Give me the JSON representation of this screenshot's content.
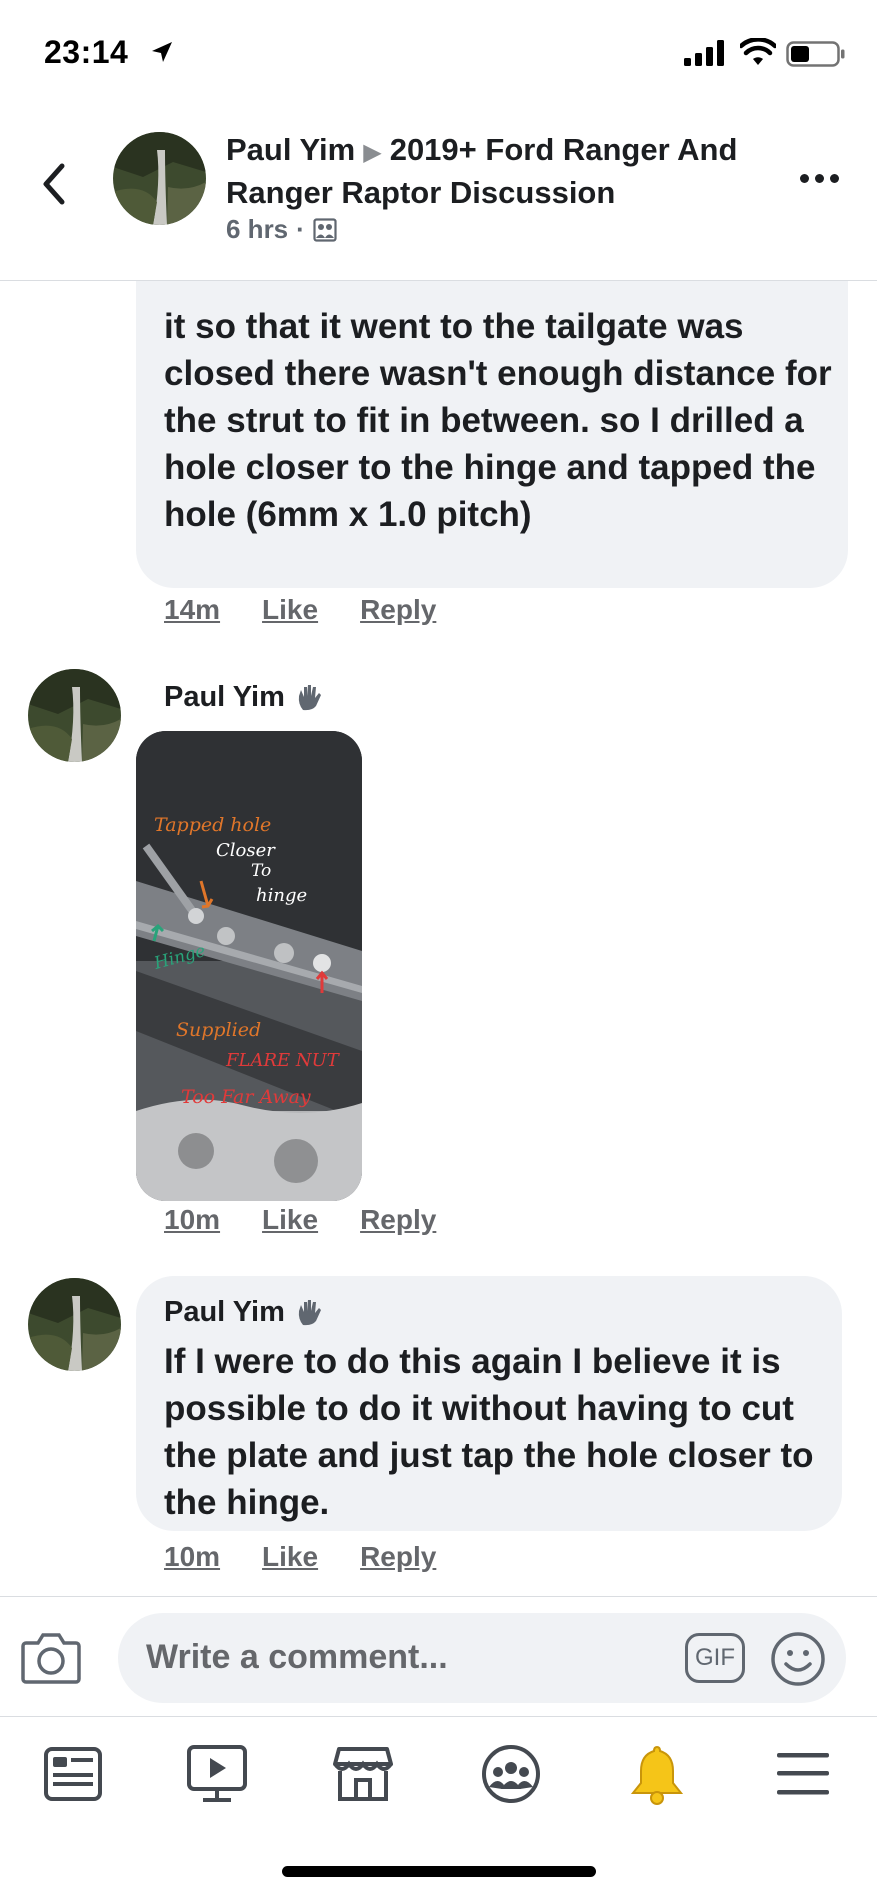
{
  "status_bar": {
    "time": "23:14",
    "icons": [
      "location-arrow-icon",
      "cellular-signal-icon",
      "wifi-icon",
      "battery-icon"
    ]
  },
  "header": {
    "author": "Paul Yim",
    "separator_icon": "play-triangle-icon",
    "group": "2019+ Ford Ranger And Ranger Raptor Discussion",
    "time": "6 hrs",
    "privacy_icon": "group-members-icon",
    "back_icon": "chevron-left-icon",
    "more_icon": "more-dots-icon"
  },
  "comments": [
    {
      "partial_text": "it so that it went to the tailgate was closed there wasn't enough distance for the strut to fit in between. so I drilled a hole closer to the hinge and tapped the hole (6mm x 1.0 pitch)",
      "time": "14m",
      "like": "Like",
      "reply": "Reply"
    },
    {
      "author": "Paul Yim",
      "badge_icon": "wave-hand-icon",
      "photo": {
        "annotations": [
          "Tapped hole",
          "Closer",
          "To",
          "hinge",
          "Hinge",
          "Supplied",
          "FLARE NUT",
          "Too Far Away"
        ]
      },
      "time": "10m",
      "like": "Like",
      "reply": "Reply"
    },
    {
      "author": "Paul Yim",
      "badge_icon": "wave-hand-icon",
      "text": "If I were to do this again I believe it is possible to do it without having to cut the plate and just tap the hole closer to the hinge.",
      "time": "10m",
      "like": "Like",
      "reply": "Reply"
    }
  ],
  "composer": {
    "placeholder": "Write a comment...",
    "gif_label": "GIF",
    "camera_icon": "camera-icon",
    "emoji_icon": "smiley-icon"
  },
  "tabbar": {
    "tabs": [
      "news-feed-icon",
      "watch-video-icon",
      "marketplace-icon",
      "groups-icon",
      "notifications-bell-icon",
      "menu-icon"
    ],
    "colors": {
      "bell": "#f5c518",
      "icon": "#444950"
    }
  }
}
